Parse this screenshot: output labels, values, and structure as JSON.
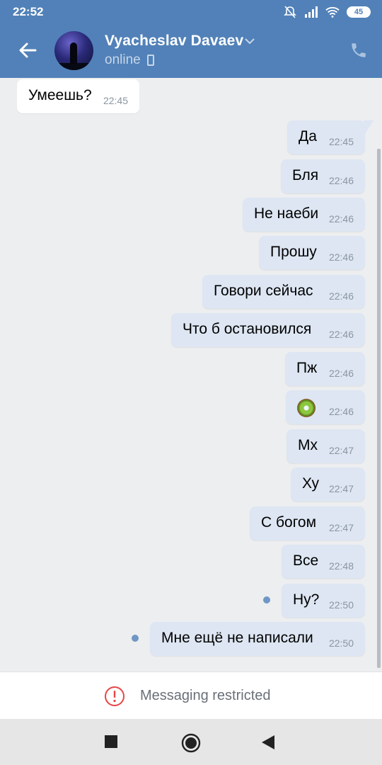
{
  "statusbar": {
    "time": "22:52",
    "battery": "45",
    "icons": [
      "mute-icon",
      "signal-icon",
      "wifi-icon",
      "battery-icon"
    ]
  },
  "header": {
    "contact_name": "Vyacheslav Davaev",
    "status": "online",
    "icons": [
      "back-arrow-icon",
      "chevron-down-icon",
      "mobile-device-icon",
      "phone-icon"
    ],
    "accent_color": "#5181b8"
  },
  "messages": [
    {
      "dir": "in",
      "text": "Умеешь?",
      "time": "22:45"
    },
    {
      "dir": "out",
      "text": "Да",
      "time": "22:45"
    },
    {
      "dir": "out",
      "text": "Бля",
      "time": "22:46"
    },
    {
      "dir": "out",
      "text": "Не наеби",
      "time": "22:46"
    },
    {
      "dir": "out",
      "text": "Прошу",
      "time": "22:46"
    },
    {
      "dir": "out",
      "text": "Говори сейчас",
      "time": "22:46"
    },
    {
      "dir": "out",
      "text": "Что б остановился",
      "time": "22:46"
    },
    {
      "dir": "out",
      "text": "Пж",
      "time": "22:46"
    },
    {
      "dir": "out",
      "text": "",
      "emoji": "kiwi-emoji",
      "time": "22:46"
    },
    {
      "dir": "out",
      "text": "Мх",
      "time": "22:47"
    },
    {
      "dir": "out",
      "text": "Ху",
      "time": "22:47"
    },
    {
      "dir": "out",
      "text": "С богом",
      "time": "22:47"
    },
    {
      "dir": "out",
      "text": "Все",
      "time": "22:48"
    },
    {
      "dir": "out",
      "text": "Ну?",
      "time": "22:50",
      "unread": true
    },
    {
      "dir": "out",
      "text": "Мне ещё не написали",
      "time": "22:50",
      "unread": true
    }
  ],
  "footer": {
    "restricted_text": "Messaging restricted",
    "icon": "alert-circle-icon"
  },
  "navbar": {
    "icons": [
      "recents-square-icon",
      "home-circle-icon",
      "back-triangle-icon"
    ]
  }
}
